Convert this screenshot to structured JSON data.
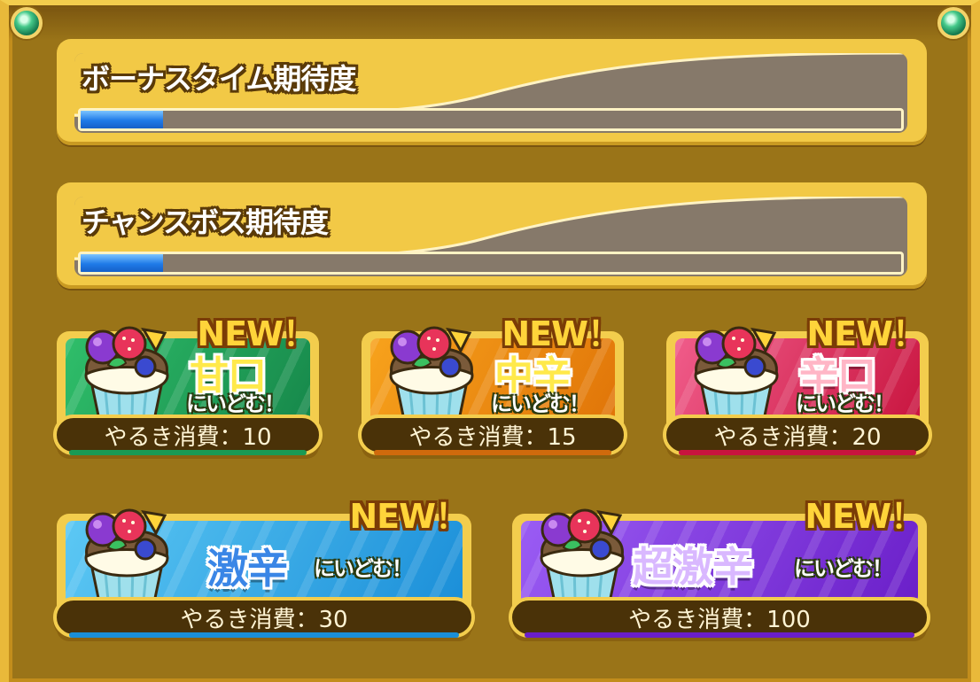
{
  "meters": [
    {
      "title": "ボーナスタイム期待度",
      "level": 0.1
    },
    {
      "title": "チャンスボス期待度",
      "level": 0.1
    }
  ],
  "buttons": [
    {
      "badge": "NEW！",
      "label": "甘口",
      "sub": "にいどむ！",
      "cost_label": "やるき消費：10",
      "color_a": "#2fbe6a",
      "color_b": "#16874a",
      "label_color": "#ffe94a",
      "strip": "#1a9a54"
    },
    {
      "badge": "NEW！",
      "label": "中辛",
      "sub": "にいどむ！",
      "cost_label": "やるき消費：15",
      "color_a": "#f7a21c",
      "color_b": "#e07408",
      "label_color": "#ffe94a",
      "strip": "#d06a0c"
    },
    {
      "badge": "NEW！",
      "label": "辛口",
      "sub": "にいどむ！",
      "cost_label": "やるき消費：20",
      "color_a": "#f05c8a",
      "color_b": "#c8143e",
      "label_color": "#ffb6c6",
      "strip": "#c8143e"
    },
    {
      "badge": "NEW！",
      "label": "激辛",
      "sub": "にいどむ！",
      "cost_label": "やるき消費：30",
      "color_a": "#5cc8f4",
      "color_b": "#1a8ed8",
      "label_color": "#3a86e6",
      "strip": "#1a8ed8"
    },
    {
      "badge": "NEW！",
      "label": "超激辛",
      "sub": "にいどむ！",
      "cost_label": "やるき消費：100",
      "color_a": "#9a5cf4",
      "color_b": "#6a1ec8",
      "label_color": "#d9b8ff",
      "strip": "#6a1ec8"
    }
  ]
}
